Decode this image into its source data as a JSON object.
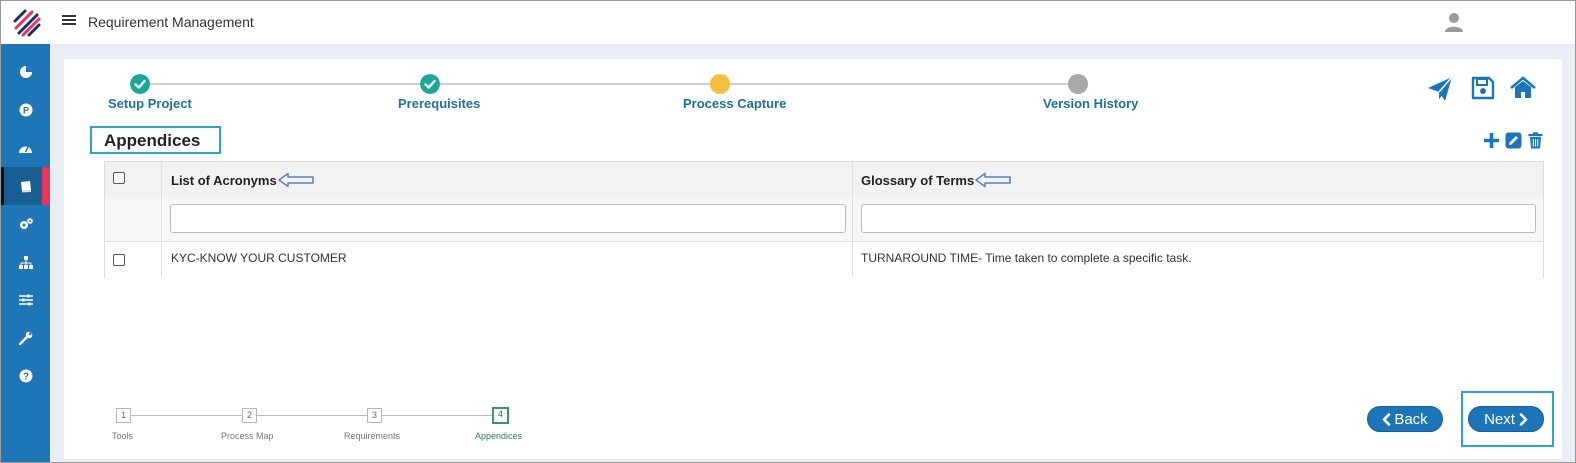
{
  "header": {
    "app_title": "Requirement Management"
  },
  "sidebar": {
    "items": [
      {
        "icon": "pie-chart-icon"
      },
      {
        "icon": "p-circle-icon"
      },
      {
        "icon": "dashboard-gauge-icon"
      },
      {
        "icon": "book-icon",
        "active": true
      },
      {
        "icon": "cogs-icon"
      },
      {
        "icon": "sitemap-icon"
      },
      {
        "icon": "sliders-icon"
      },
      {
        "icon": "wrench-icon"
      },
      {
        "icon": "help-icon"
      }
    ]
  },
  "stepper": {
    "steps": [
      {
        "label": "Setup Project",
        "status": "done"
      },
      {
        "label": "Prerequisites",
        "status": "done"
      },
      {
        "label": "Process Capture",
        "status": "current"
      },
      {
        "label": "Version History",
        "status": "pending"
      }
    ]
  },
  "section": {
    "title": "Appendices"
  },
  "table": {
    "columns": [
      "List of Acronyms",
      "Glossary of Terms"
    ],
    "filter_values": [
      "",
      ""
    ],
    "rows": [
      [
        "KYC-KNOW YOUR CUSTOMER",
        "TURNAROUND TIME- Time taken to complete a specific task."
      ]
    ]
  },
  "wizard": {
    "steps": [
      {
        "num": "1",
        "label": "Tools"
      },
      {
        "num": "2",
        "label": "Process Map"
      },
      {
        "num": "3",
        "label": "Requirements"
      },
      {
        "num": "4",
        "label": "Appendices",
        "active": true
      }
    ]
  },
  "buttons": {
    "back": "Back",
    "next": "Next"
  },
  "colors": {
    "primary": "#1c75b8",
    "done": "#1ba69a",
    "current": "#f7bd3c",
    "pending": "#a8a8a8",
    "highlight": "#2ba3d3"
  }
}
